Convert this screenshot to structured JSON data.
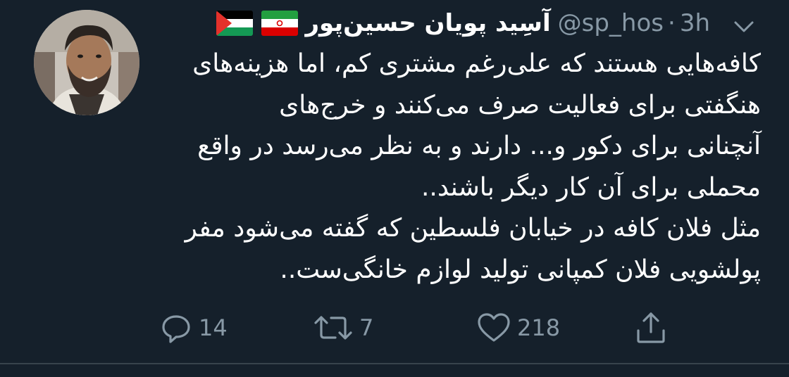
{
  "tweet": {
    "display_name": "آسِید پویان حسین‌پور",
    "handle": "@sp_hos",
    "separator": "·",
    "time": "3h",
    "flags": [
      "palestine-flag",
      "iran-flag"
    ],
    "text_lines": [
      "کافه‌هایی هستند که علی‌رغم مشتری کم، اما هزینه‌های",
      "هنگفتی برای فعالیت صرف می‌کنند و خرج‌های",
      "آنچنانی برای دکور و... دارند و به نظر می‌رسد در واقع",
      "محملی برای آن کار دیگر باشند..",
      "مثل فلان کافه در خیابان فلسطین که گفته می‌شود مفر",
      "پولشویی فلان کمپانی تولید لوازم خانگی‌ست.."
    ],
    "actions": {
      "reply_count": "14",
      "retweet_count": "7",
      "like_count": "218"
    }
  },
  "colors": {
    "background": "#15202b",
    "text": "#ffffff",
    "secondary": "#8899a6",
    "divider": "#38444d"
  },
  "icons": [
    "caret-down-icon",
    "reply-icon",
    "retweet-icon",
    "like-icon",
    "share-icon"
  ]
}
